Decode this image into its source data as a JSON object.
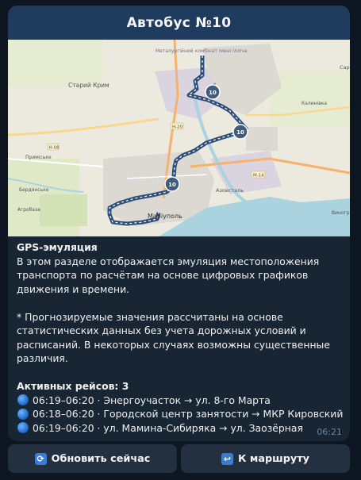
{
  "header": {
    "title": "Автобус №10"
  },
  "map": {
    "labels": {
      "stary_krym": "Старий Крим",
      "metal_combine": "Металургійний комбінат імені Ілліча",
      "prymorske": "Приміське",
      "berdianske": "Бердянське",
      "agrobaza": "Агробаза",
      "mariupol": "Маріуполь",
      "azovstal": "Азовсталь",
      "kalynivka": "Калинівка",
      "sartana": "Сар",
      "vynohrad": "Виногр",
      "road_h20": "H-20",
      "road_h08": "H-08",
      "road_m14": "M-14"
    },
    "bus_marker": "10"
  },
  "message": {
    "heading": "GPS-эмуляция",
    "paragraph1": "В этом разделе отображается эмуляция местоположения транспорта по расчётам на основе цифровых графиков движения и времени.",
    "paragraph2": "* Прогнозируемые значения рассчитаны на основе статистических данных без учета дорожных условий и расписаний. В некоторых случаях возможны существенные различия.",
    "active_title": "Активных рейсов: 3",
    "trips": [
      "06:19–06:20 · Энергоучасток → ул. 8-го Марта",
      "06:18–06:20 · Городской центр занятости → МКР Кировский",
      "06:19–06:20 · ул. Мамина-Сибиряка → ул. Заозёрная"
    ],
    "time": "06:21"
  },
  "buttons": {
    "refresh": {
      "label": "Обновить сейчас",
      "icon": "refresh-icon"
    },
    "route": {
      "label": "К маршруту",
      "icon": "back-arrow-icon"
    }
  },
  "colors": {
    "background": "#0e1621",
    "bubble": "#182533",
    "header": "#1f3b5e",
    "route": "#2e4f7a",
    "marker": "#3f5c80"
  }
}
